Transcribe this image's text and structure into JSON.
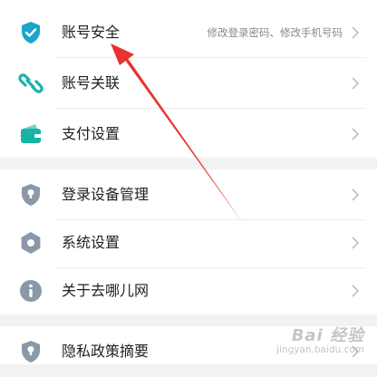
{
  "colors": {
    "accent": "#1aa5c9",
    "teal": "#17b3a6",
    "gray_icon": "#8a98a8",
    "arrow": "#e8322f",
    "chevron": "#b8b8b8"
  },
  "groups": [
    {
      "items": [
        {
          "label": "账号安全",
          "subtitle": "修改登录密码、修改手机号码",
          "icon": "shield-check-icon"
        },
        {
          "label": "账号关联",
          "subtitle": "",
          "icon": "link-icon"
        },
        {
          "label": "支付设置",
          "subtitle": "",
          "icon": "wallet-icon"
        }
      ]
    },
    {
      "items": [
        {
          "label": "登录设备管理",
          "subtitle": "",
          "icon": "device-shield-icon"
        },
        {
          "label": "系统设置",
          "subtitle": "",
          "icon": "gear-icon"
        },
        {
          "label": "关于去哪儿网",
          "subtitle": "",
          "icon": "info-icon"
        }
      ]
    },
    {
      "items": [
        {
          "label": "隐私政策摘要",
          "subtitle": "",
          "icon": "privacy-shield-icon"
        }
      ]
    }
  ],
  "watermark": {
    "logo": "Bai 经验",
    "url": "jingyan.baidu.com"
  }
}
